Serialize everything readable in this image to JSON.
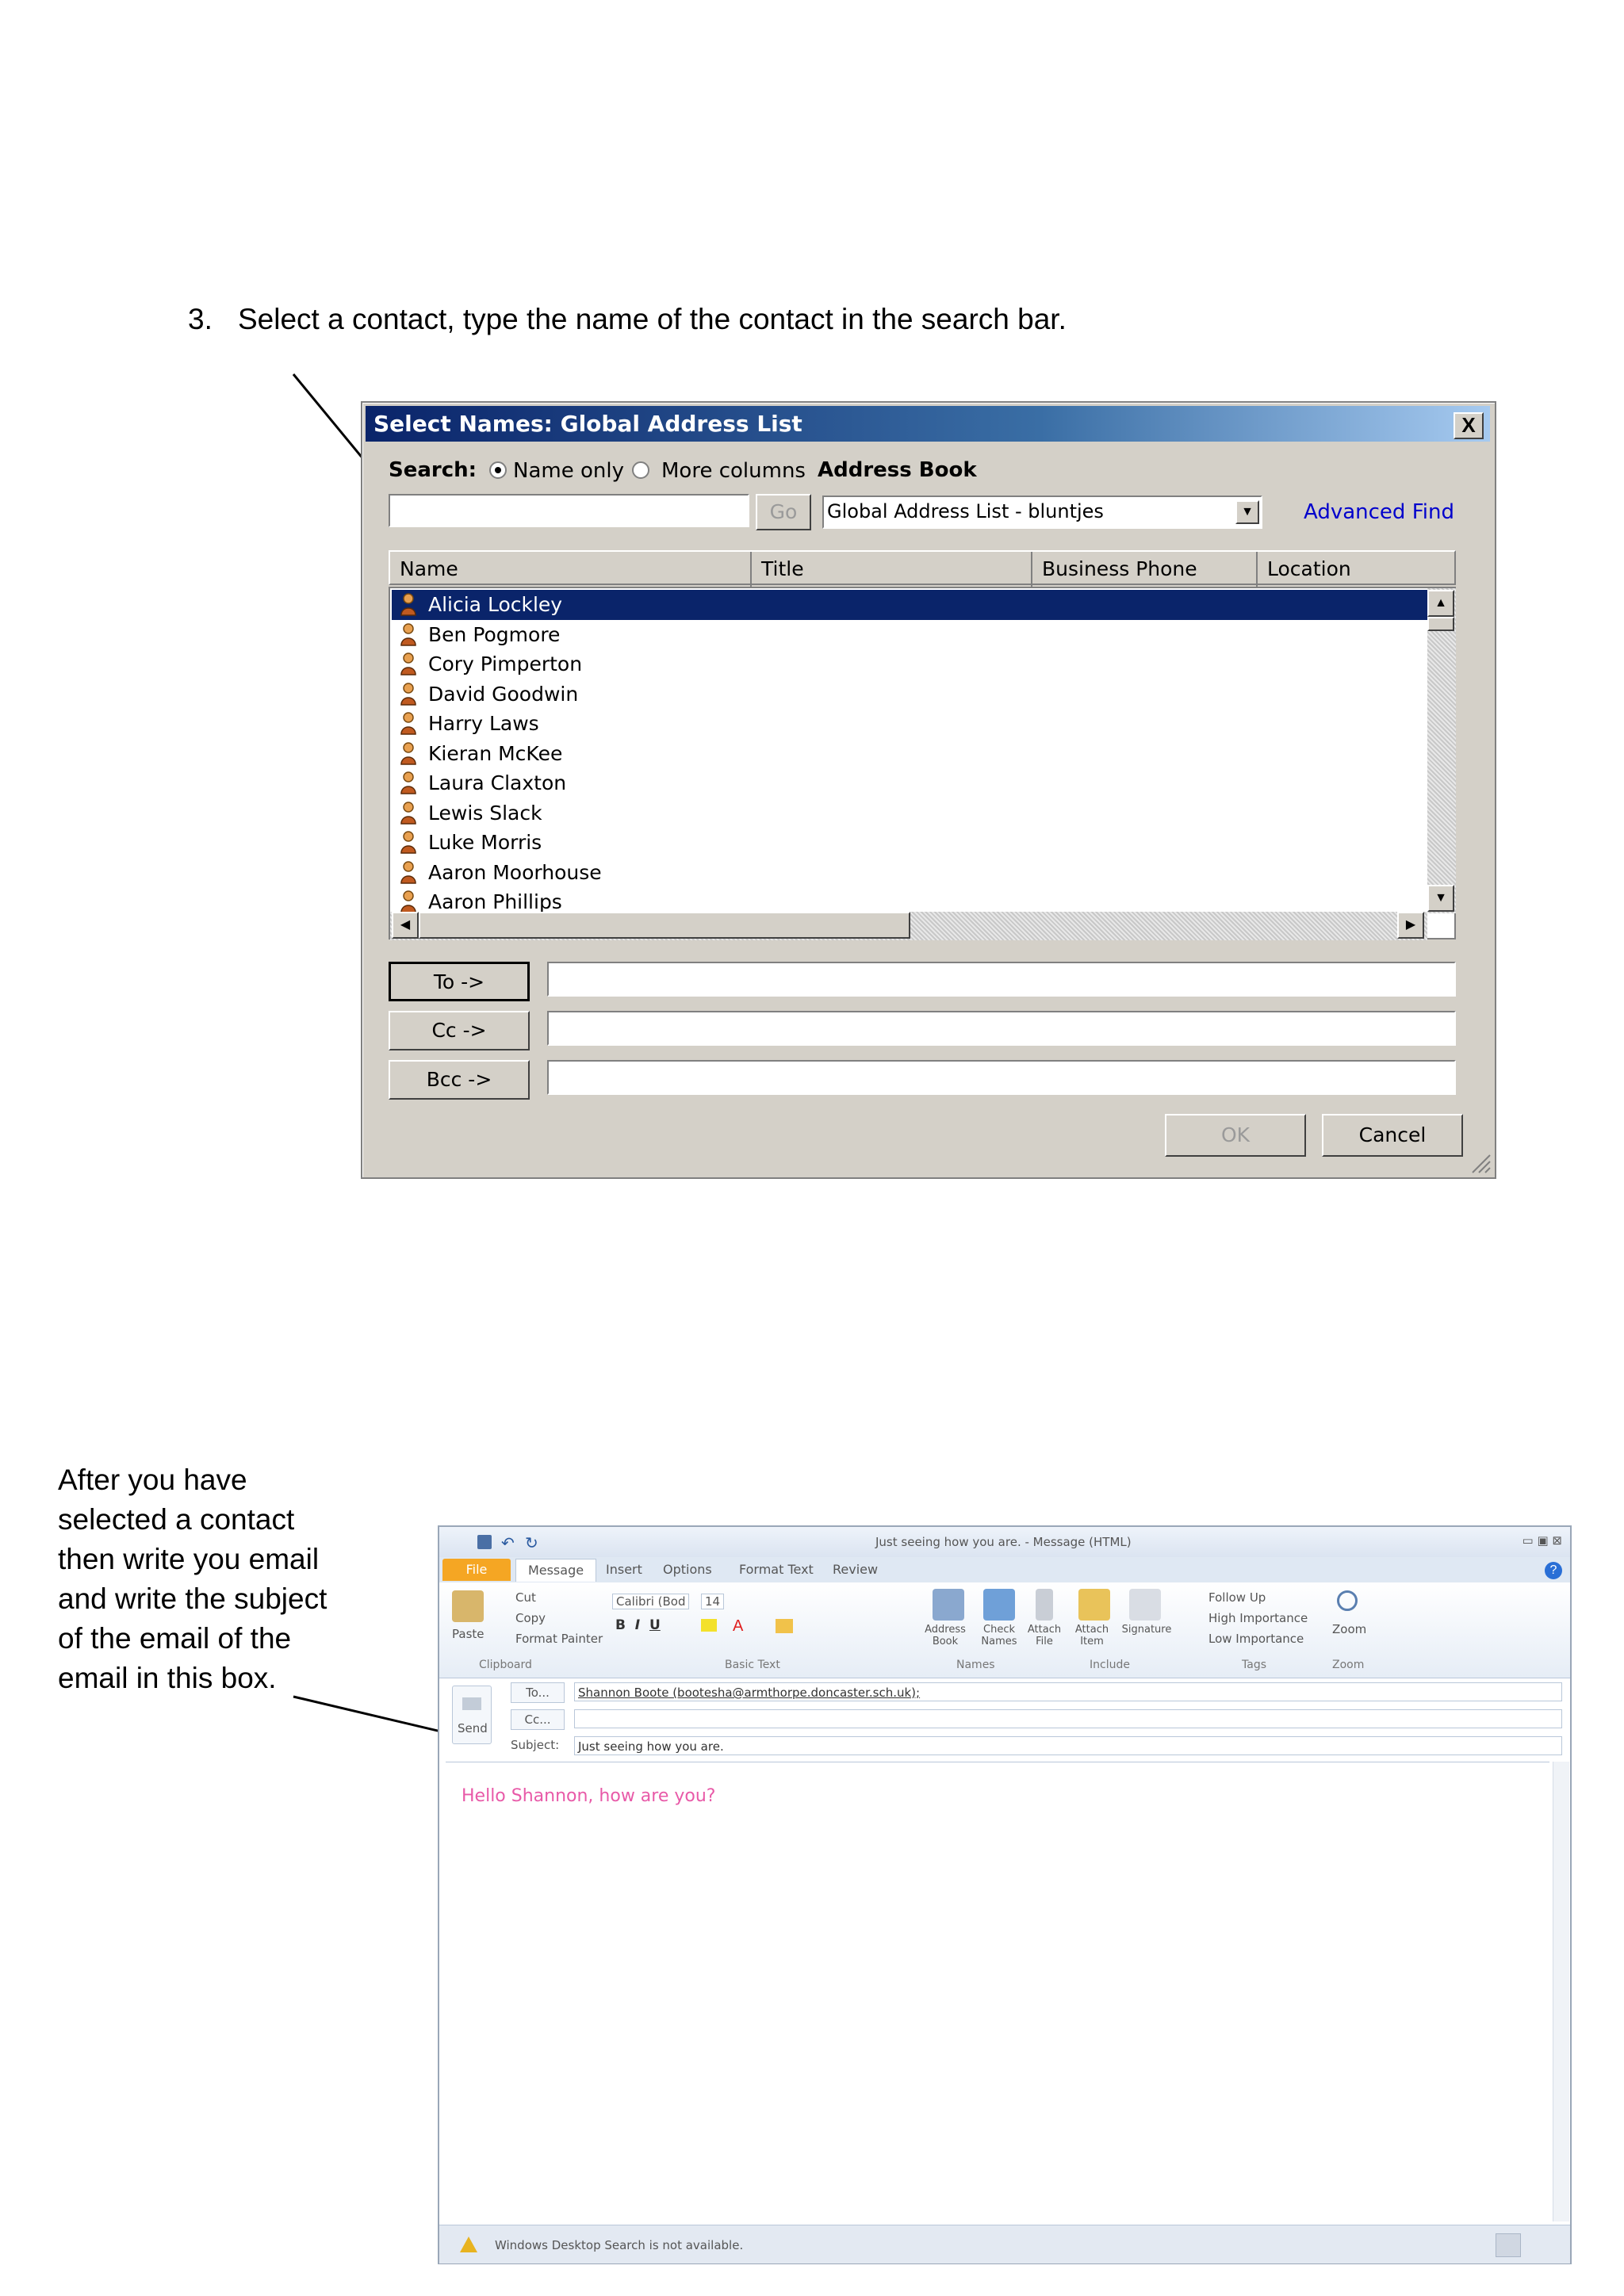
{
  "instruction": {
    "step_number": "3.",
    "text": "Select a contact, type the name of the contact in the search bar."
  },
  "dialog": {
    "title": "Select Names: Global Address List",
    "close_glyph": "X",
    "search_label": "Search:",
    "radio_name_only": "Name only",
    "radio_more_columns": "More columns",
    "address_book_label": "Address Book",
    "search_value": "",
    "go_label": "Go",
    "address_book_value": "Global Address List - bluntjes",
    "advanced_find": "Advanced Find",
    "columns": [
      "Name",
      "Title",
      "Business Phone",
      "Location"
    ],
    "contacts": [
      "Alicia Lockley",
      "Ben Pogmore",
      "Cory Pimperton",
      "David Goodwin",
      "Harry Laws",
      "Kieran McKee",
      "Laura Claxton",
      "Lewis Slack",
      "Luke Morris",
      "Aaron Moorhouse",
      "Aaron Phillips"
    ],
    "selected_contact_index": 0,
    "to_label": "To ->",
    "cc_label": "Cc ->",
    "bcc_label": "Bcc ->",
    "ok_label": "OK",
    "cancel_label": "Cancel",
    "colors": {
      "title_start": "#0a246a",
      "title_end": "#a6caf0",
      "selection": "#0a246a",
      "link": "#0000cc"
    }
  },
  "side_note": {
    "lines": [
      "After you have",
      "selected a contact",
      "then write you email",
      "and write the subject",
      "of the email of the",
      "email in this box."
    ]
  },
  "message_window": {
    "title": "Just seeing how you are. - Message (HTML)",
    "tabs": [
      "File",
      "Message",
      "Insert",
      "Options",
      "Format Text",
      "Review"
    ],
    "clipboard": {
      "paste": "Paste",
      "cut": "Cut",
      "copy": "Copy",
      "format_painter": "Format Painter",
      "group": "Clipboard"
    },
    "basic_text": {
      "font": "Calibri (Bod",
      "size": "14",
      "group": "Basic Text"
    },
    "names": {
      "address_book": "Address Book",
      "check_names": "Check Names",
      "group": "Names"
    },
    "include": {
      "attach_file": "Attach File",
      "attach_item": "Attach Item",
      "signature": "Signature",
      "group": "Include"
    },
    "tags": {
      "follow_up": "Follow Up",
      "high_importance": "High Importance",
      "low_importance": "Low Importance",
      "group": "Tags"
    },
    "zoom": {
      "label": "Zoom",
      "group": "Zoom"
    },
    "send_label": "Send",
    "to_label": "To...",
    "cc_label": "Cc...",
    "subject_label": "Subject:",
    "to_value": "Shannon Boote (bootesha@armthorpe.doncaster.sch.uk);",
    "cc_value": "",
    "subject_value": "Just seeing how you are.",
    "body_text": "Hello Shannon, how are you?",
    "status_text": "Windows Desktop Search is not available.",
    "colors": {
      "file_tab": "#f5a623",
      "body_text": "#e85aa8"
    }
  }
}
